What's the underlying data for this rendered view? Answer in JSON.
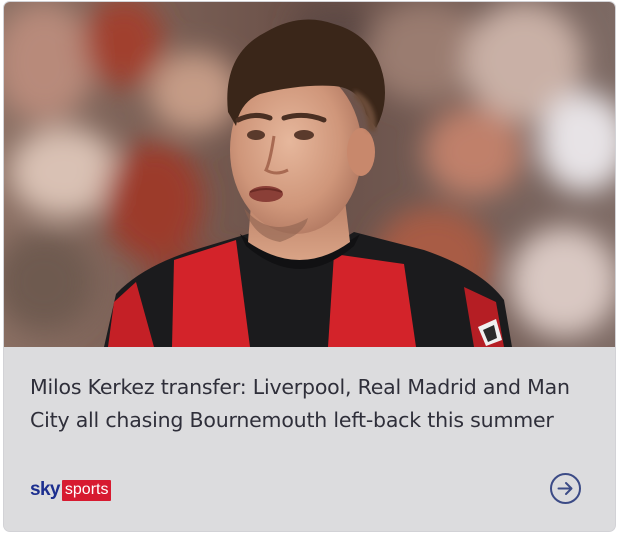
{
  "article": {
    "headline": "Milos Kerkez transfer: Liverpool, Real Madrid and Man City all chasing Bournemouth left-back this summer",
    "image_alt": "Milos Kerkez in Bournemouth kit"
  },
  "brand": {
    "sky": "sky",
    "sports": "sports"
  },
  "icons": {
    "read_more": "arrow-right-circle-icon"
  },
  "colors": {
    "caption_background": "#dcdcde",
    "headline_text": "#2f2f3a",
    "sky_blue": "#1c2f8f",
    "sports_red": "#d71a30",
    "arrow_outline": "#3c4b86"
  }
}
